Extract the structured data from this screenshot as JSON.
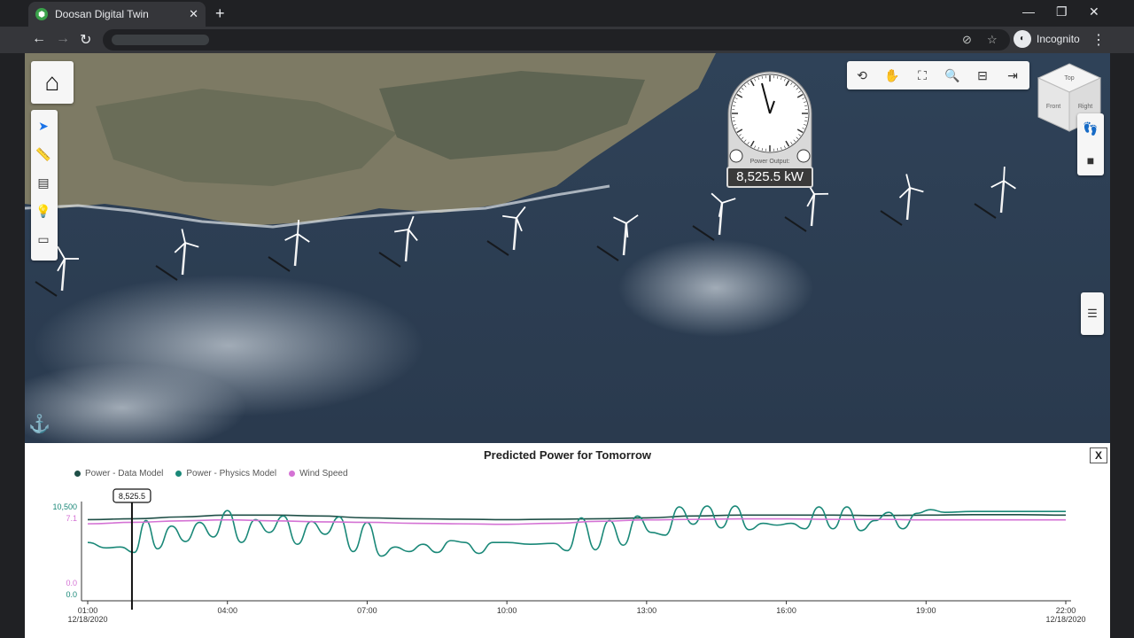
{
  "browser": {
    "tab_title": "Doosan Digital Twin",
    "tab_favicon": "doosan-logo-icon",
    "incognito_label": "Incognito"
  },
  "viewer": {
    "gauge_label": "Power Output:",
    "gauge_value": "8,525.5 kW",
    "navcube_faces": [
      "Top",
      "Front",
      "Right"
    ],
    "top_tools": [
      "rotate-icon",
      "pan-hand-icon",
      "fit-view-icon",
      "zoom-icon",
      "camera-view-icon",
      "fullscreen-icon"
    ],
    "left_tools": [
      "select-arrow-icon",
      "measure-icon",
      "section-icon",
      "light-bulb-icon",
      "window-icon"
    ],
    "right_tools": [
      "walk-icon",
      "video-camera-icon"
    ],
    "tree_tool": "model-tree-icon"
  },
  "chart_panel": {
    "close_label": "X"
  },
  "chart_data": {
    "type": "line",
    "title": "Predicted Power for Tomorrow",
    "legend_position": "top-left",
    "x_ticks": [
      "01:00",
      "04:00",
      "07:00",
      "10:00",
      "13:00",
      "16:00",
      "19:00",
      "22:00"
    ],
    "x_first_date": "12/18/2020",
    "x_last_date": "12/18/2020",
    "xlim": [
      1,
      22
    ],
    "y_power_ticks": [
      "10,500",
      "0.0"
    ],
    "y_wind_ticks": [
      "7.1",
      "0.0"
    ],
    "y_power_lim": [
      0,
      10500
    ],
    "y_wind_lim": [
      0,
      7.1
    ],
    "cursor": {
      "x": 1.95,
      "label": "8,525.5"
    },
    "colors": {
      "data_model": "#1f4f47",
      "physics_model": "#1a8878",
      "wind_speed": "#d472d4"
    },
    "series": [
      {
        "name": "Power - Data Model",
        "axis": "power",
        "color": "#1f4f47",
        "x": [
          1,
          2,
          3,
          4,
          5,
          6,
          7,
          8,
          9,
          10,
          11,
          12,
          13,
          14,
          15,
          16,
          17,
          18,
          19,
          20,
          21,
          22
        ],
        "y": [
          8900,
          9000,
          9200,
          9400,
          9400,
          9300,
          9100,
          9000,
          8950,
          8900,
          8950,
          9000,
          9100,
          9300,
          9400,
          9400,
          9400,
          9350,
          9400,
          9450,
          9450,
          9400
        ]
      },
      {
        "name": "Power - Physics Model",
        "axis": "power",
        "color": "#1a8878",
        "x": [
          1,
          1.4,
          1.7,
          2.0,
          2.25,
          2.5,
          2.8,
          3.1,
          3.4,
          3.7,
          4.0,
          4.3,
          4.6,
          4.9,
          5.2,
          5.5,
          5.8,
          6.1,
          6.4,
          6.7,
          7.0,
          7.3,
          7.6,
          7.9,
          8.2,
          8.5,
          8.8,
          9.1,
          9.4,
          9.7,
          10.0,
          10.5,
          11.0,
          11.3,
          11.6,
          11.9,
          12.2,
          12.5,
          12.8,
          13.1,
          13.4,
          13.7,
          14.0,
          14.3,
          14.6,
          14.9,
          15.2,
          15.5,
          15.8,
          16.1,
          16.4,
          16.7,
          17.0,
          17.3,
          17.6,
          17.9,
          18.2,
          18.5,
          18.8,
          19.1,
          19.4,
          20.0,
          21.0,
          22.0
        ],
        "y": [
          6400,
          5800,
          5900,
          5300,
          8800,
          5700,
          8200,
          6500,
          8600,
          7000,
          9900,
          6400,
          8900,
          7500,
          9300,
          6200,
          8700,
          7300,
          9200,
          5400,
          8600,
          4900,
          5900,
          5400,
          6200,
          5300,
          6600,
          6400,
          5200,
          6400,
          6400,
          6200,
          6300,
          5500,
          9100,
          5600,
          8800,
          6100,
          9300,
          7500,
          7200,
          10300,
          8400,
          10400,
          8000,
          10400,
          7800,
          8500,
          8300,
          8500,
          7900,
          10300,
          7900,
          10300,
          7700,
          8800,
          9700,
          7900,
          9600,
          10000,
          9700,
          9800,
          9800,
          9800
        ]
      },
      {
        "name": "Wind Speed",
        "axis": "wind",
        "color": "#d472d4",
        "x": [
          1,
          2,
          3,
          4,
          5,
          6,
          7,
          8,
          9,
          10,
          11,
          12,
          13,
          14,
          15,
          16,
          17,
          18,
          19,
          20,
          21,
          22
        ],
        "y": [
          6.55,
          6.7,
          6.85,
          6.95,
          6.85,
          6.75,
          6.7,
          6.6,
          6.55,
          6.5,
          6.6,
          6.8,
          6.95,
          7.0,
          7.05,
          7.05,
          7.0,
          7.0,
          6.95,
          6.95,
          6.95,
          6.95
        ]
      }
    ]
  }
}
